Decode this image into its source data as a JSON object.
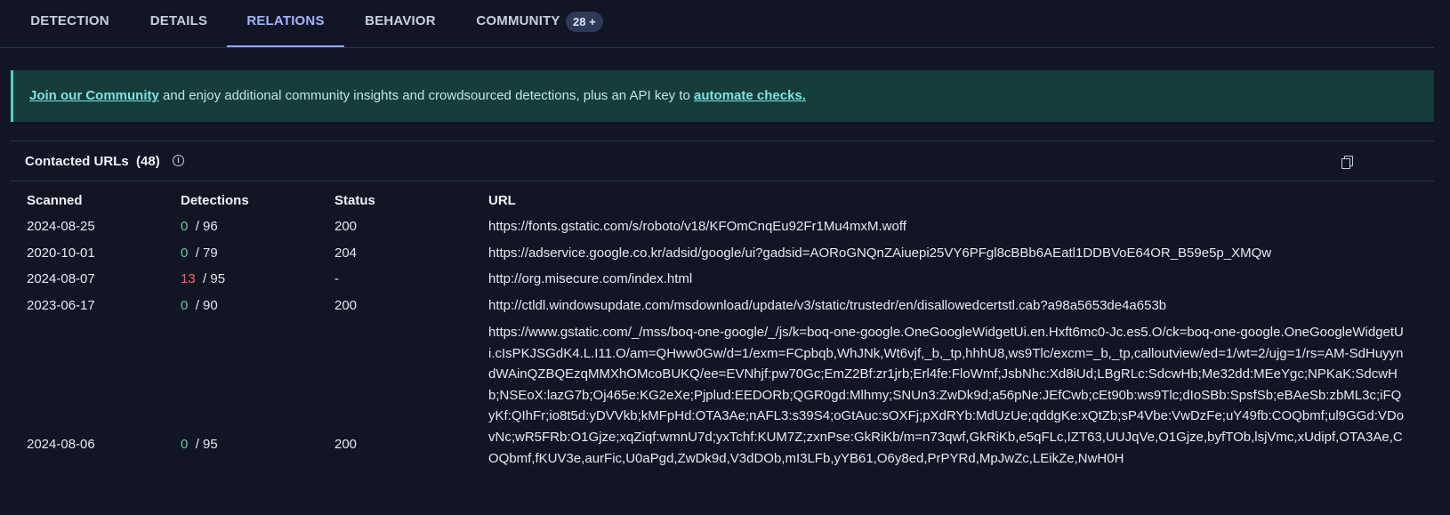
{
  "tabs": [
    {
      "label": "DETECTION"
    },
    {
      "label": "DETAILS"
    },
    {
      "label": "RELATIONS"
    },
    {
      "label": "BEHAVIOR"
    },
    {
      "label": "COMMUNITY"
    }
  ],
  "community_badge": "28 +",
  "banner": {
    "link1": "Join our Community",
    "text": " and enjoy additional community insights and crowdsourced detections, plus an API key to ",
    "link2": "automate checks."
  },
  "section": {
    "title": "Contacted URLs",
    "count": "(48)",
    "info_icon": "info-icon",
    "copy_icon": "copy-icon"
  },
  "table": {
    "headers": [
      "Scanned",
      "Detections",
      "Status",
      "URL"
    ],
    "rows": [
      {
        "scanned": "2024-08-25",
        "det": "0",
        "total": "/ 96",
        "status": "200",
        "url": "https://fonts.gstatic.com/s/roboto/v18/KFOmCnqEu92Fr1Mu4mxM.woff"
      },
      {
        "scanned": "2020-10-01",
        "det": "0",
        "total": "/ 79",
        "status": "204",
        "url": "https://adservice.google.co.kr/adsid/google/ui?gadsid=AORoGNQnZAiuepi25VY6PFgl8cBBb6AEatl1DDBVoE64OR_B59e5p_XMQw"
      },
      {
        "scanned": "2024-08-07",
        "det": "13",
        "total": "/ 95",
        "status": "-",
        "url": "http://org.misecure.com/index.html"
      },
      {
        "scanned": "2023-06-17",
        "det": "0",
        "total": "/ 90",
        "status": "200",
        "url": "http://ctldl.windowsupdate.com/msdownload/update/v3/static/trustedr/en/disallowedcertstl.cab?a98a5653de4a653b"
      },
      {
        "scanned": "2024-08-06",
        "det": "0",
        "total": "/ 95",
        "status": "200",
        "url": "https://www.gstatic.com/_/mss/boq-one-google/_/js/k=boq-one-google.OneGoogleWidgetUi.en.Hxft6mc0-Jc.es5.O/ck=boq-one-google.OneGoogleWidgetUi.cIsPKJSGdK4.L.I11.O/am=QHww0Gw/d=1/exm=FCpbqb,WhJNk,Wt6vjf,_b,_tp,hhhU8,ws9Tlc/excm=_b,_tp,calloutview/ed=1/wt=2/ujg=1/rs=AM-SdHuyyndWAinQZBQEzqMMXhOMcoBUKQ/ee=EVNhjf:pw70Gc;EmZ2Bf:zr1jrb;Erl4fe:FloWmf;JsbNhc:Xd8iUd;LBgRLc:SdcwHb;Me32dd:MEeYgc;NPKaK:SdcwHb;NSEoX:lazG7b;Oj465e:KG2eXe;Pjplud:EEDORb;QGR0gd:Mlhmy;SNUn3:ZwDk9d;a56pNe:JEfCwb;cEt90b:ws9Tlc;dIoSBb:SpsfSb;eBAeSb:zbML3c;iFQyKf:QIhFr;io8t5d:yDVVkb;kMFpHd:OTA3Ae;nAFL3:s39S4;oGtAuc:sOXFj;pXdRYb:MdUzUe;qddgKe:xQtZb;sP4Vbe:VwDzFe;uY49fb:COQbmf;ul9GGd:VDovNc;wR5FRb:O1Gjze;xqZiqf:wmnU7d;yxTchf:KUM7Z;zxnPse:GkRiKb/m=n73qwf,GkRiKb,e5qFLc,IZT63,UUJqVe,O1Gjze,byfTOb,lsjVmc,xUdipf,OTA3Ae,COQbmf,fKUV3e,aurFic,U0aPgd,ZwDk9d,V3dDOb,mI3LFb,yYB61,O6y8ed,PrPYRd,MpJwZc,LEikZe,NwH0H"
      }
    ]
  },
  "colors": {
    "active_tab": "#9fb5ff",
    "clean": "#5fcf9b",
    "malicious": "#ff5c6c",
    "banner_bg": "#153d3c"
  }
}
